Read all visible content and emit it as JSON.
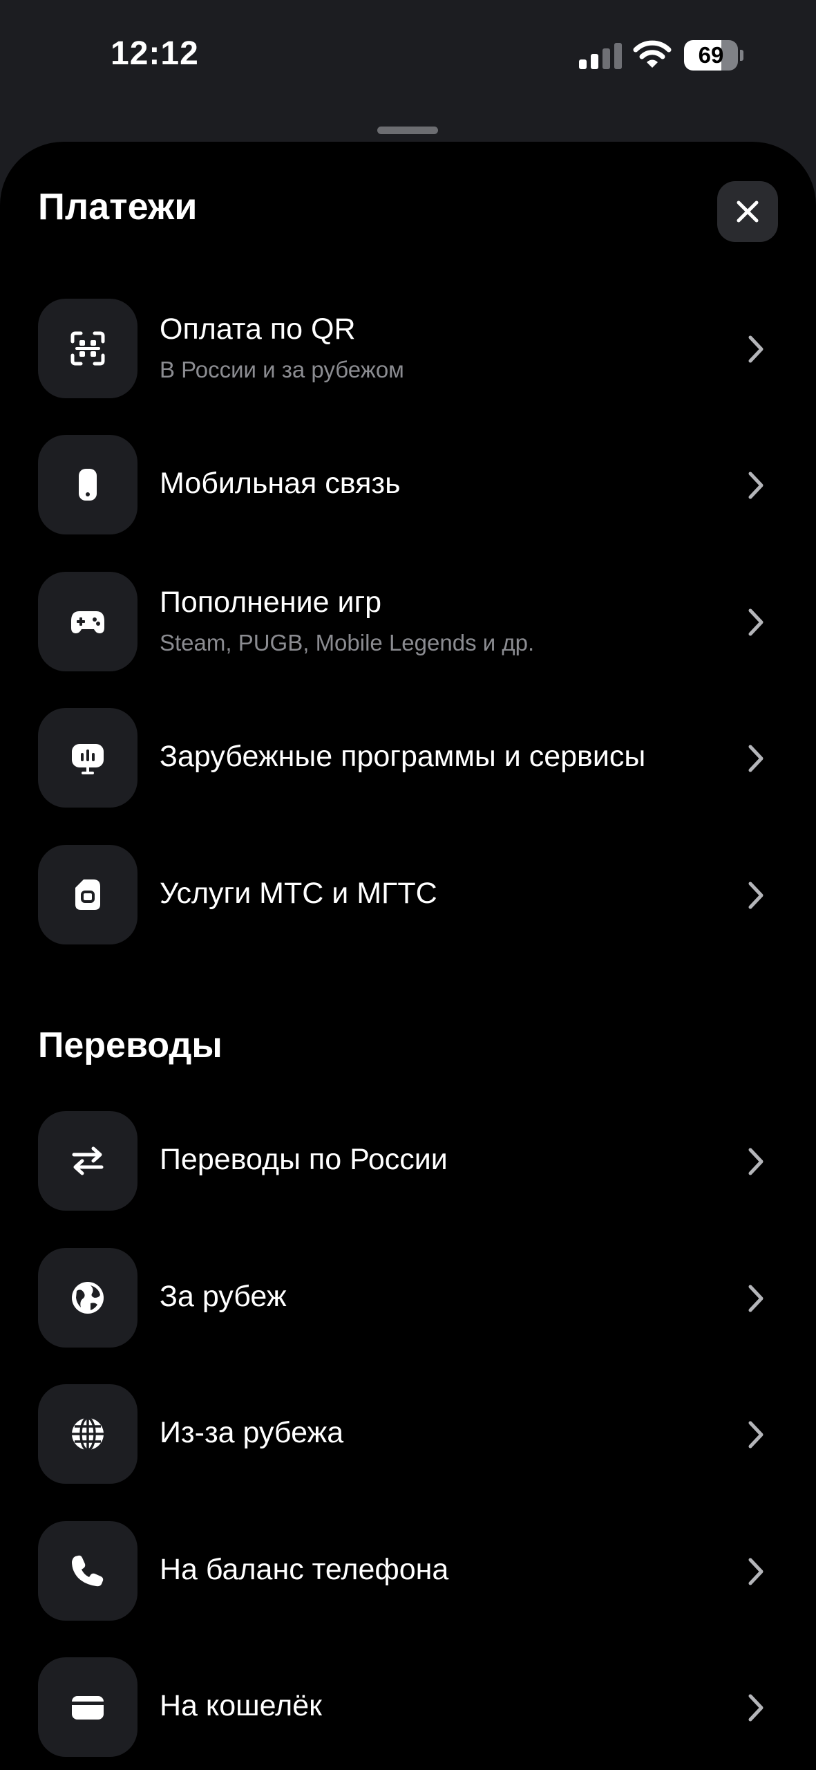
{
  "status_bar": {
    "time": "12:12",
    "battery_percent": "69",
    "battery_level": 0.69
  },
  "sheet": {
    "title": "Платежи",
    "close_icon": "close-icon"
  },
  "payments": [
    {
      "label": "Оплата по QR",
      "subtitle": "В России и за рубежом",
      "icon": "qr-scan-icon"
    },
    {
      "label": "Мобильная связь",
      "icon": "mobile-phone-icon"
    },
    {
      "label": "Пополнение игр",
      "subtitle": "Steam, PUGB, Mobile Legends и др.",
      "icon": "gamepad-icon"
    },
    {
      "label": "Зарубежные программы и сервисы",
      "icon": "monitor-icon"
    },
    {
      "label": "Услуги МТС и МГТС",
      "icon": "sim-card-icon"
    }
  ],
  "transfers": {
    "title": "Переводы",
    "items": [
      {
        "label": "Переводы по России",
        "icon": "transfer-arrows-icon"
      },
      {
        "label": "За рубеж",
        "icon": "globe-icon"
      },
      {
        "label": "Из-за рубежа",
        "icon": "globe-grid-icon"
      },
      {
        "label": "На баланс телефона",
        "icon": "phone-handset-icon"
      },
      {
        "label": "На кошелёк",
        "icon": "wallet-icon"
      }
    ]
  },
  "colors": {
    "background": "#000000",
    "tile": "#1d1e22",
    "subtitle": "#8b8c91",
    "chevron": "#b4b5b9"
  }
}
